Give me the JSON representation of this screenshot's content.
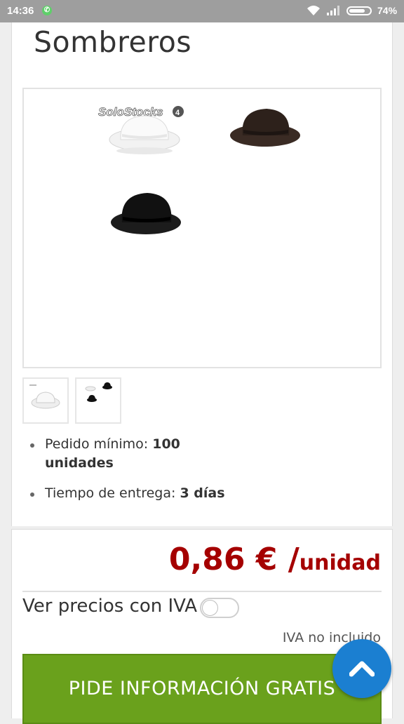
{
  "status_bar": {
    "time": "14:36",
    "battery": "74%",
    "icons": [
      "whatsapp-call-icon",
      "wifi-icon",
      "signal-icon",
      "battery-icon"
    ]
  },
  "product": {
    "title": "Sombreros",
    "watermark": "SoloStocks",
    "images": [
      "hat-white",
      "hat-brown",
      "hat-black"
    ],
    "thumbnails": [
      "thumbnail-white-hat",
      "thumbnail-all-hats"
    ]
  },
  "details": {
    "min_order_label": "Pedido mínimo:",
    "min_order_value": "100",
    "min_order_unit": "unidades",
    "delivery_label": "Tiempo de entrega:",
    "delivery_value": "3 días"
  },
  "pricing": {
    "price": "0,86 € /",
    "unit": "unidad",
    "iva_toggle_label": "Ver precios con IVA",
    "iva_toggle_on": false,
    "iva_note": "IVA no incluido",
    "price_color": "#a50000"
  },
  "cta": {
    "label": "PIDE INFORMACIÓN GRATIS",
    "color": "#6aa11c"
  },
  "fab": {
    "icon": "chevron-up-icon",
    "color": "#1b7fd1"
  }
}
